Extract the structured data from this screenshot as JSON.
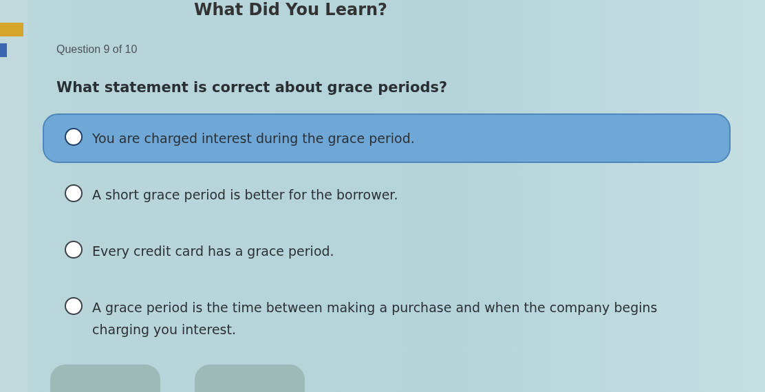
{
  "title": "What Did You Learn?",
  "progress": "Question 9 of 10",
  "question": "What statement is correct about grace periods?",
  "options": [
    {
      "label": "You are charged interest during the grace period.",
      "selected": true
    },
    {
      "label": "A short grace period is better for the borrower.",
      "selected": false
    },
    {
      "label": "Every credit card has a grace period.",
      "selected": false
    },
    {
      "label": "A grace period is the time between making a purchase and when the company begins charging you interest.",
      "selected": false
    }
  ]
}
